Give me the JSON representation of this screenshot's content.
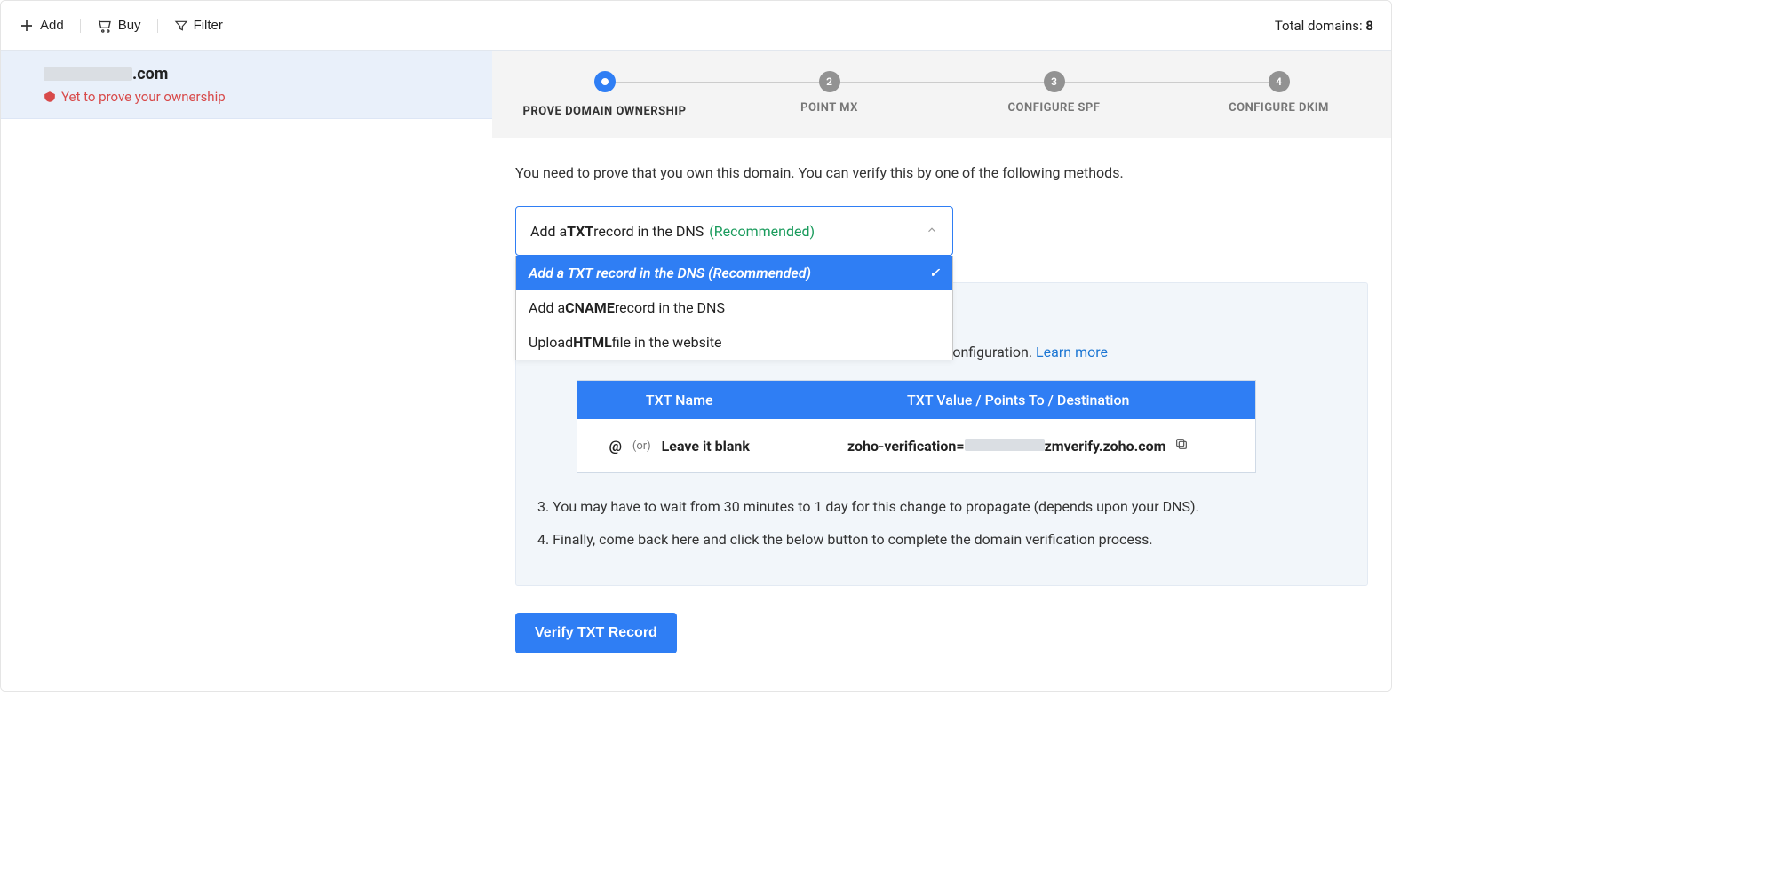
{
  "toolbar": {
    "add": "Add",
    "buy": "Buy",
    "filter": "Filter",
    "total_label": "Total domains: ",
    "total_value": "8"
  },
  "sidebar": {
    "domain_suffix": ".com",
    "ownership_text": "Yet to prove your ownership"
  },
  "stepper": {
    "steps": [
      {
        "num": "",
        "label": "PROVE DOMAIN OWNERSHIP"
      },
      {
        "num": "2",
        "label": "POINT MX"
      },
      {
        "num": "3",
        "label": "CONFIGURE SPF"
      },
      {
        "num": "4",
        "label": "CONFIGURE DKIM"
      }
    ]
  },
  "lead": "You need to prove that you own this domain. You can verify this by one of the following methods.",
  "dropdown": {
    "selected_pre": "Add a ",
    "selected_bold": "TXT",
    "selected_post": " record in the DNS",
    "recommended": "(Recommended)",
    "options": [
      {
        "text": "Add a TXT record in the DNS (Recommended)"
      },
      {
        "pre": "Add a ",
        "bold": "CNAME",
        "post": " record in the DNS"
      },
      {
        "pre": "Upload ",
        "bold": "HTML",
        "post": " file in the website"
      }
    ]
  },
  "panel": {
    "line2_pre": "NS configuration. ",
    "learn_more": "Learn more",
    "txt_name_header": "TXT Name",
    "txt_value_header": "TXT Value / Points To / Destination",
    "txt_name_at": "@",
    "txt_name_or": "(or)",
    "txt_name_blank": "Leave it blank",
    "txt_value_pre": "zoho-verification=",
    "txt_value_post": "zmverify.zoho.com",
    "line3": "3. You may have to wait from 30 minutes to 1 day for this change to propagate (depends upon your DNS).",
    "line4": "4. Finally, come back here and click the below button to complete the domain verification process."
  },
  "verify_button": "Verify TXT Record"
}
